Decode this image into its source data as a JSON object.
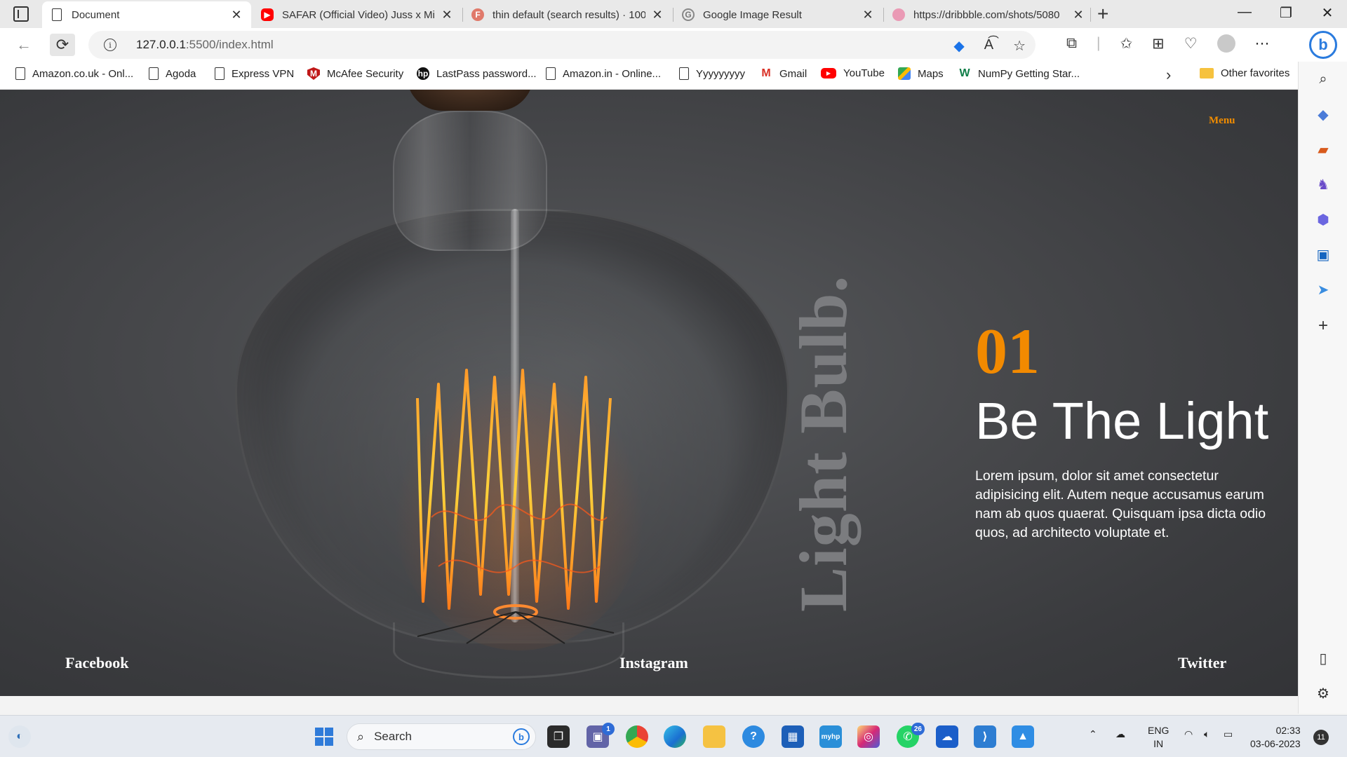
{
  "browser": {
    "tabs": [
      {
        "title": "Document",
        "favicon": "document-icon",
        "active": true
      },
      {
        "title": "SAFAR (Official Video) Juss x MixS",
        "favicon": "youtube-icon"
      },
      {
        "title": "thin default (search results) · 100",
        "favicon": "fontawesome-icon"
      },
      {
        "title": "Google Image Result",
        "favicon": "google-icon"
      },
      {
        "title": "https://dribbble.com/shots/5080",
        "favicon": "dribbble-icon"
      }
    ],
    "url_host": "127.0.0.1",
    "url_rest": ":5500/index.html",
    "favorites": [
      {
        "label": "Amazon.co.uk - Onl...",
        "icon": "document-icon"
      },
      {
        "label": "Agoda",
        "icon": "document-icon"
      },
      {
        "label": "Express VPN",
        "icon": "document-icon"
      },
      {
        "label": "McAfee Security",
        "icon": "mcafee-icon"
      },
      {
        "label": "LastPass password...",
        "icon": "hp-icon"
      },
      {
        "label": "Amazon.in - Online...",
        "icon": "document-icon"
      },
      {
        "label": "Yyyyyyyyy",
        "icon": "document-icon"
      },
      {
        "label": "Gmail",
        "icon": "gmail-icon"
      },
      {
        "label": "YouTube",
        "icon": "youtube-icon"
      },
      {
        "label": "Maps",
        "icon": "maps-icon"
      },
      {
        "label": "NumPy Getting Star...",
        "icon": "numpy-icon"
      }
    ],
    "other_favorites": "Other favorites"
  },
  "page": {
    "menu": "Menu",
    "vertical_title": "Light Bulb.",
    "slide_number": "01",
    "slide_title": "Be The Light",
    "slide_text": "Lorem ipsum, dolor sit amet consectetur adipisicing elit. Autem neque accusamus earum nam ab quos quaerat. Quisquam ipsa dicta odio quos, ad architecto voluptate et.",
    "social": {
      "facebook": "Facebook",
      "instagram": "Instagram",
      "twitter": "Twitter"
    },
    "colors": {
      "accent": "#f28a00",
      "background": "#46474a"
    }
  },
  "taskbar": {
    "search_placeholder": "Search",
    "teams_badge": "1",
    "whatsapp_badge": "26",
    "language": "ENG",
    "region": "IN",
    "time": "02:33",
    "date": "03-06-2023",
    "notifications": "11"
  }
}
